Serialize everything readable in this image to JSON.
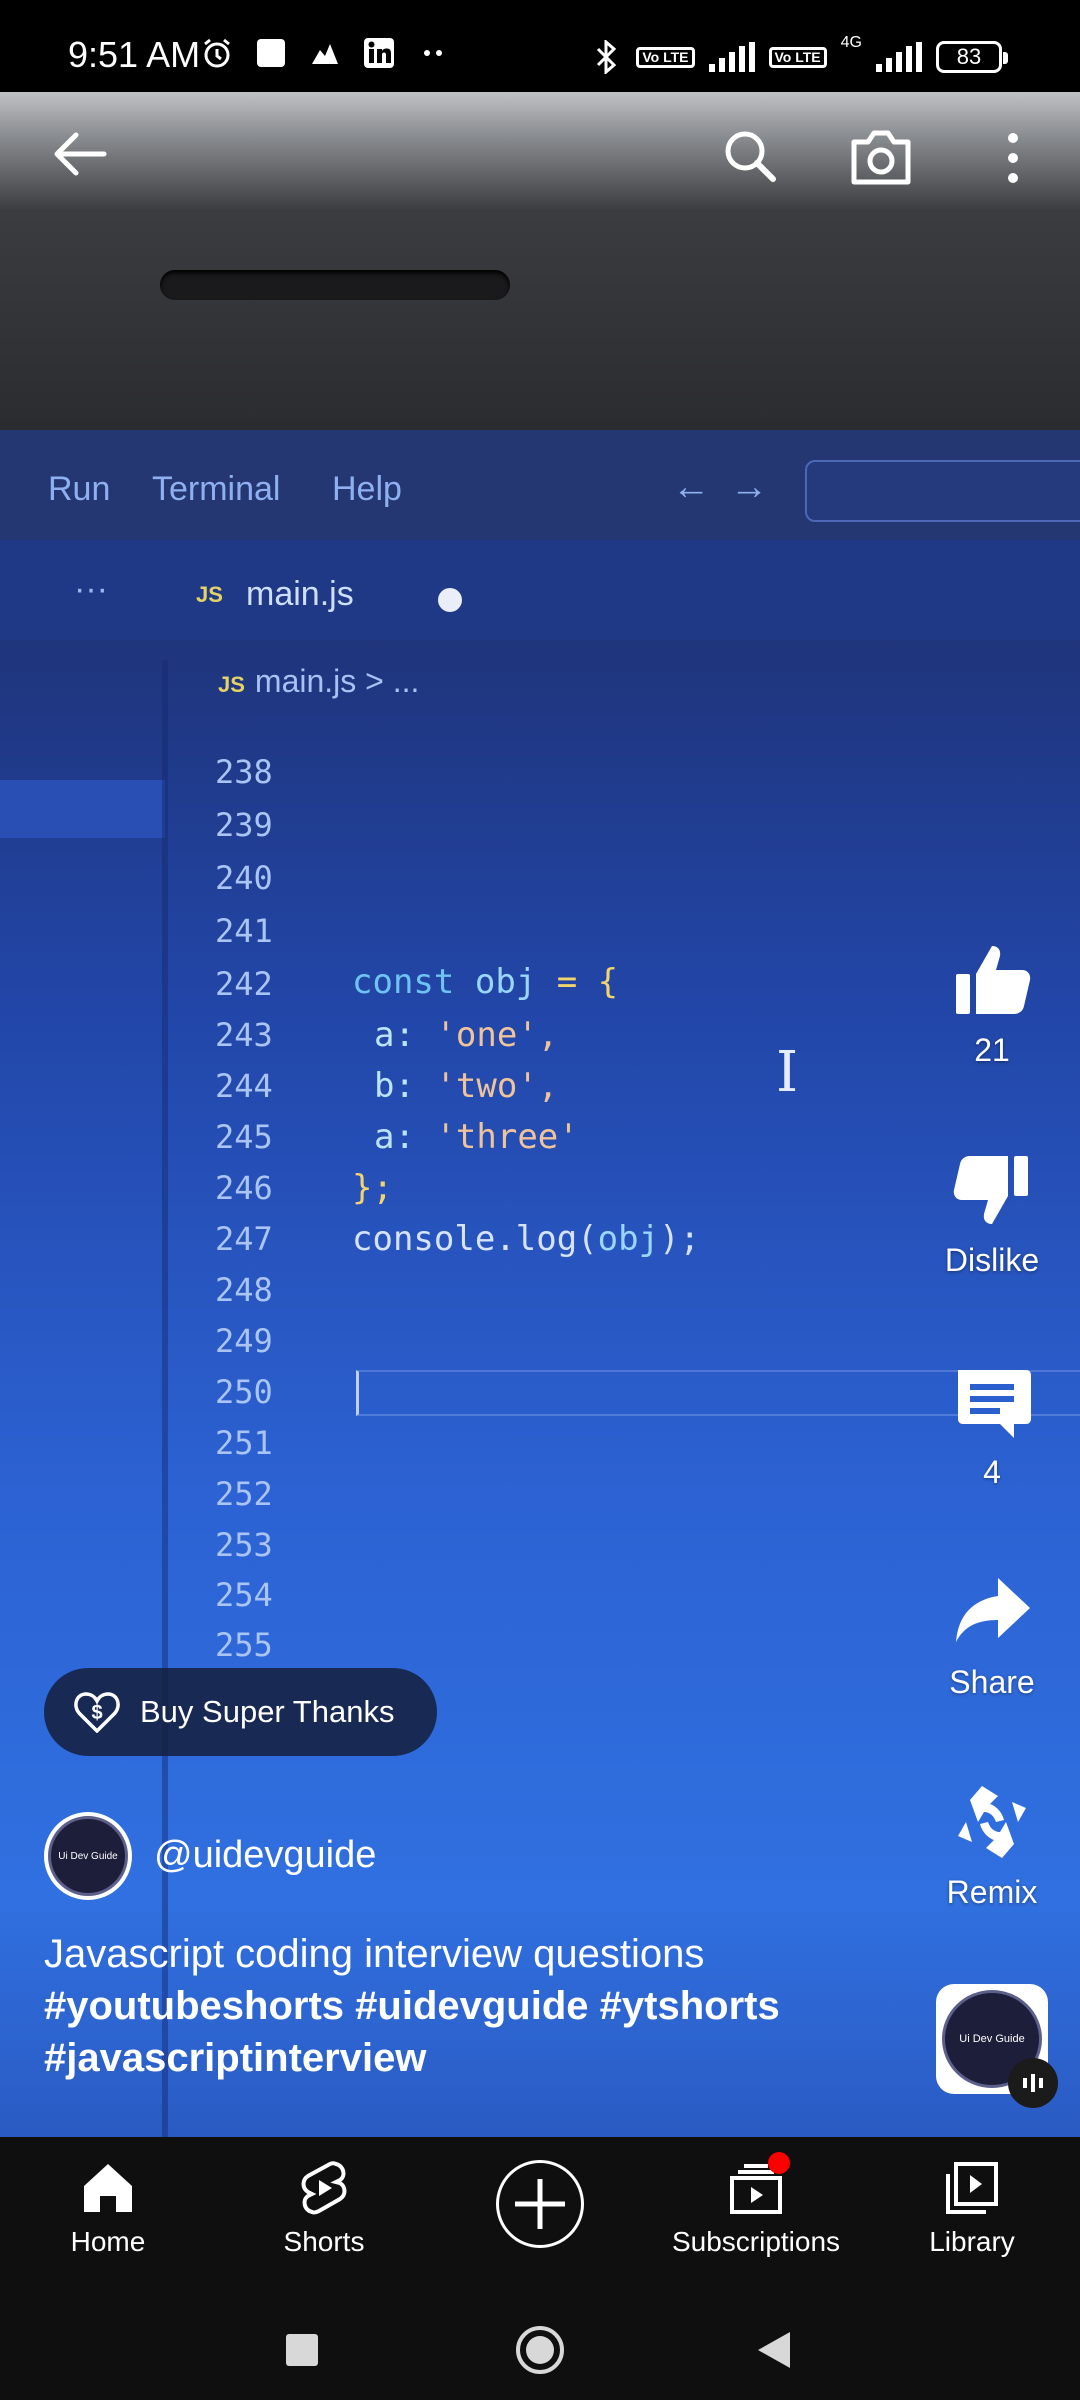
{
  "status_bar": {
    "time": "9:51 AM",
    "battery": "83",
    "network_type": "4G",
    "volte_label": "Vo LTE"
  },
  "video_content": {
    "menu": [
      "Run",
      "Terminal",
      "Help"
    ],
    "tab_badge": "JS",
    "tab_name": "main.js",
    "breadcrumb": "main.js > ...",
    "line_numbers": [
      "238",
      "239",
      "240",
      "241",
      "242",
      "243",
      "244",
      "245",
      "246",
      "247",
      "248",
      "249",
      "250",
      "251",
      "252",
      "253",
      "254",
      "255"
    ],
    "code_lines": {
      "l242_kw": "const",
      "l242_var": "obj",
      "l242_rest": " = {",
      "l243_prop": "a:",
      "l243_val": "'one',",
      "l244_prop": "b:",
      "l244_val": "'two',",
      "l245_prop": "a:",
      "l245_val": "'three'",
      "l246": "};",
      "l247_a": "console.log(",
      "l247_var": "obj",
      "l247_b": ");"
    }
  },
  "top_controls": {
    "back": "back-arrow-icon",
    "search": "search-icon",
    "camera": "camera-icon",
    "more": "more-vert-icon"
  },
  "actions": {
    "like_count": "21",
    "dislike_label": "Dislike",
    "comment_count": "4",
    "share_label": "Share",
    "remix_label": "Remix"
  },
  "overlay": {
    "super_thanks": "Buy Super Thanks",
    "avatar_text": "Ui Dev Guide",
    "channel": "@uidevguide",
    "title": "Javascript coding interview questions",
    "hashtags": "#youtubeshorts #uidevguide #ytshorts #javascriptinterview"
  },
  "bottom_nav": {
    "home": "Home",
    "shorts": "Shorts",
    "subscriptions": "Subscriptions",
    "library": "Library"
  },
  "colors": {
    "accent_red": "#ff0000",
    "nav_bg": "#0f0f0f",
    "screen_blue": "#2c62d3"
  }
}
